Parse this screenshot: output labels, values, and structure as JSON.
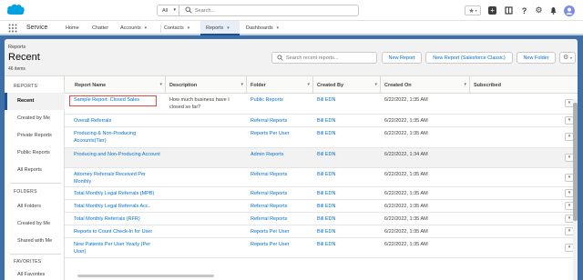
{
  "app": {
    "name": "Service"
  },
  "search": {
    "scope": "All",
    "placeholder": "Search..."
  },
  "nav": {
    "items": [
      {
        "label": "Home",
        "dropdown": false
      },
      {
        "label": "Chatter",
        "dropdown": false
      },
      {
        "label": "Accounts",
        "dropdown": true
      },
      {
        "label": "Contacts",
        "dropdown": true
      },
      {
        "label": "Reports",
        "dropdown": true,
        "active": true
      },
      {
        "label": "Dashboards",
        "dropdown": true
      }
    ]
  },
  "header": {
    "breadcrumb": "Reports",
    "title": "Recent",
    "count": "46 items",
    "search_placeholder": "Search recent reports...",
    "buttons": {
      "new_report": "New Report",
      "new_report_classic": "New Report (Salesforce Classic)",
      "new_folder": "New Folder"
    }
  },
  "sidebar": {
    "sections": [
      {
        "title": "REPORTS",
        "items": [
          "Recent",
          "Created by Me",
          "Private Reports",
          "Public Reports",
          "All Reports"
        ]
      },
      {
        "title": "FOLDERS",
        "items": [
          "All Folders",
          "Created by Me",
          "Shared with Me"
        ]
      },
      {
        "title": "FAVORITES",
        "items": [
          "All Favorites"
        ]
      }
    ],
    "active": "Recent"
  },
  "table": {
    "columns": [
      "Report Name",
      "Description",
      "Folder",
      "Created By",
      "Created On",
      "Subscribed"
    ],
    "rows": [
      {
        "name": "Sample Report: Closed Sales",
        "description": "How much business have I closed so far?",
        "folder": "Public Reports",
        "created_by": "Bill EDN",
        "created_on": "6/22/2022, 1:35 AM"
      },
      {
        "name": "Overall Referrals",
        "description": "",
        "folder": "Referral Reports",
        "created_by": "Bill EDN",
        "created_on": "6/22/2022, 1:35 AM"
      },
      {
        "name": "Producing & Non-Producing Accounts(Tier)",
        "description": "",
        "folder": "Reports Per User",
        "created_by": "Bill EDN",
        "created_on": "6/22/2022, 1:35 AM"
      },
      {
        "name": "Producing and Non-Producing Account",
        "description": "",
        "folder": "Admin Reports",
        "created_by": "Bill EDN",
        "created_on": "6/22/2022, 1:34 AM"
      },
      {
        "name": "Attorney Referrals Received Per Monthly",
        "description": "",
        "folder": "Referral Reports",
        "created_by": "Bill EDN",
        "created_on": "6/22/2022, 1:35 AM"
      },
      {
        "name": "Total Monthly Legal Referrals (MPB)",
        "description": "",
        "folder": "Referral Reports",
        "created_by": "Bill EDN",
        "created_on": "6/22/2022, 1:35 AM"
      },
      {
        "name": "Total Monthly Legal Referrals Acc..",
        "description": "",
        "folder": "Referral Reports",
        "created_by": "Bill EDN",
        "created_on": "6/22/2022, 1:35 AM"
      },
      {
        "name": "Total Monthly Referrals (RFR)",
        "description": "",
        "folder": "Referral Reports",
        "created_by": "Bill EDN",
        "created_on": "6/22/2022, 1:35 AM"
      },
      {
        "name": "Reports to Count Check-In for User",
        "description": "",
        "folder": "Reports Per User",
        "created_by": "Bill EDN",
        "created_on": "6/22/2022, 1:35 AM"
      },
      {
        "name": "New Patients Per User Yearly (Per User)",
        "description": "",
        "folder": "Reports Per User",
        "created_by": "Bill EDN",
        "created_on": "6/22/2022, 1:35 AM"
      }
    ]
  },
  "colors": {
    "brand_blue": "#3d6fa8",
    "link": "#0070d2",
    "highlight_box": "#e74c3c",
    "active_nav": "#1b5297"
  },
  "icons": [
    "salesforce-cloud-icon",
    "search-icon",
    "star-icon",
    "plus-icon",
    "setup-assistant-icon",
    "help-icon",
    "gear-icon",
    "bell-icon",
    "avatar-icon",
    "app-launcher-icon",
    "chevron-down-icon",
    "row-action-chevron-icon"
  ]
}
